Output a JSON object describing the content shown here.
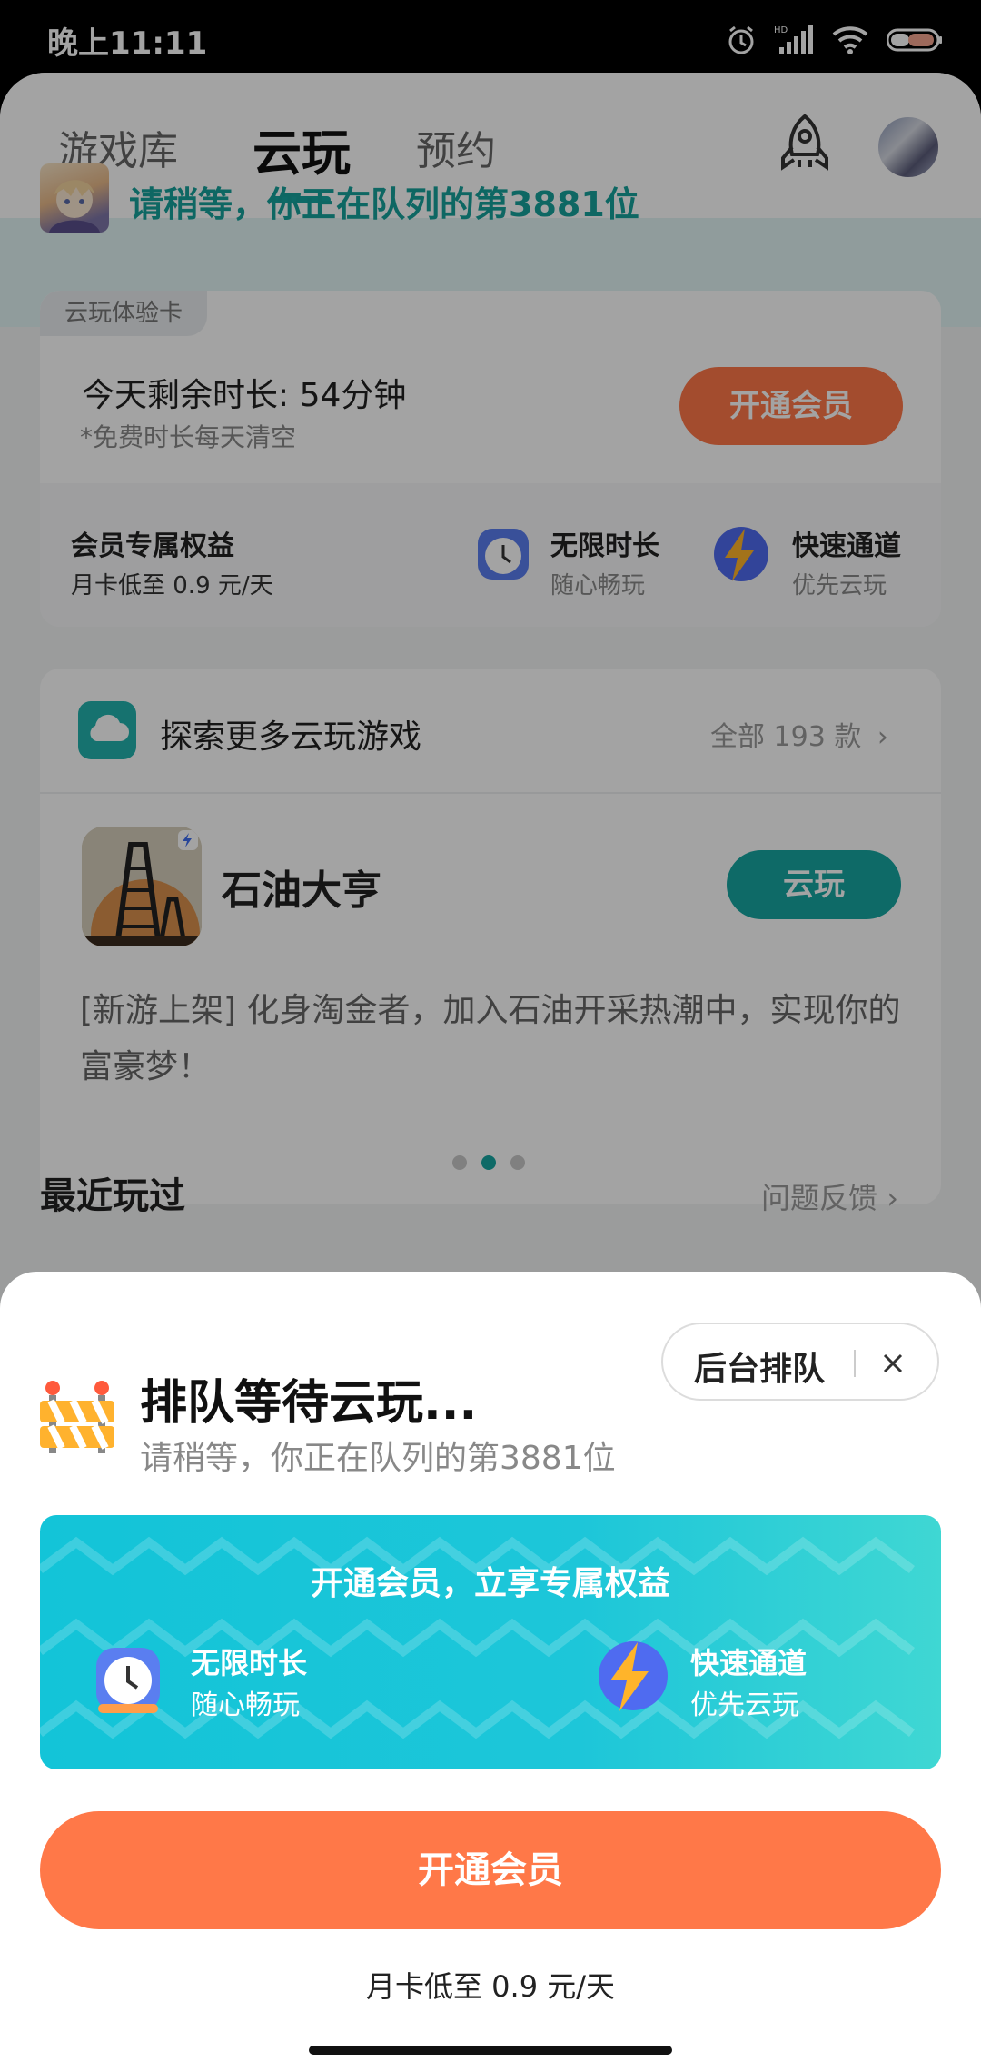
{
  "status_bar": {
    "time": "晚上11:11"
  },
  "tabs": [
    {
      "label": "游戏库",
      "active": false
    },
    {
      "label": "云玩",
      "active": true
    },
    {
      "label": "预约",
      "active": false
    }
  ],
  "queue_banner": {
    "text": "请稍等，你正在队列的第3881位"
  },
  "trial_card": {
    "tag": "云玩体验卡",
    "remaining": "今天剩余时长: 54分钟",
    "note": "*免费时长每天清空",
    "button": "开通会员",
    "benefits_title": "会员专属权益",
    "price": "月卡低至 0.9 元/天",
    "benefits": [
      {
        "title": "无限时长",
        "sub": "随心畅玩",
        "icon": "alarm-clock-icon"
      },
      {
        "title": "快速通道",
        "sub": "优先云玩",
        "icon": "lightning-icon"
      }
    ]
  },
  "explore_card": {
    "title": "探索更多云玩游戏",
    "all": "全部 193 款",
    "game_name": "石油大亨",
    "game_button": "云玩",
    "description": "[新游上架] 化身淘金者，加入石油开采热潮中，实现你的富豪梦！",
    "carousel_active_index": 1
  },
  "recent": {
    "title": "最近玩过",
    "feedback": "问题反馈"
  },
  "sheet": {
    "title": "排队等待云玩...",
    "subtitle": "请稍等，你正在队列的第3881位",
    "background_queue": "后台排队",
    "promo_title": "开通会员，立享专属权益",
    "promo_items": [
      {
        "title": "无限时长",
        "sub": "随心畅玩"
      },
      {
        "title": "快速通道",
        "sub": "优先云玩"
      }
    ],
    "cta": "开通会员",
    "price": "月卡低至 0.9 元/天"
  },
  "colors": {
    "accent": "#16a7a2",
    "orange": "#ff7848",
    "promo": "#13c4d8"
  }
}
